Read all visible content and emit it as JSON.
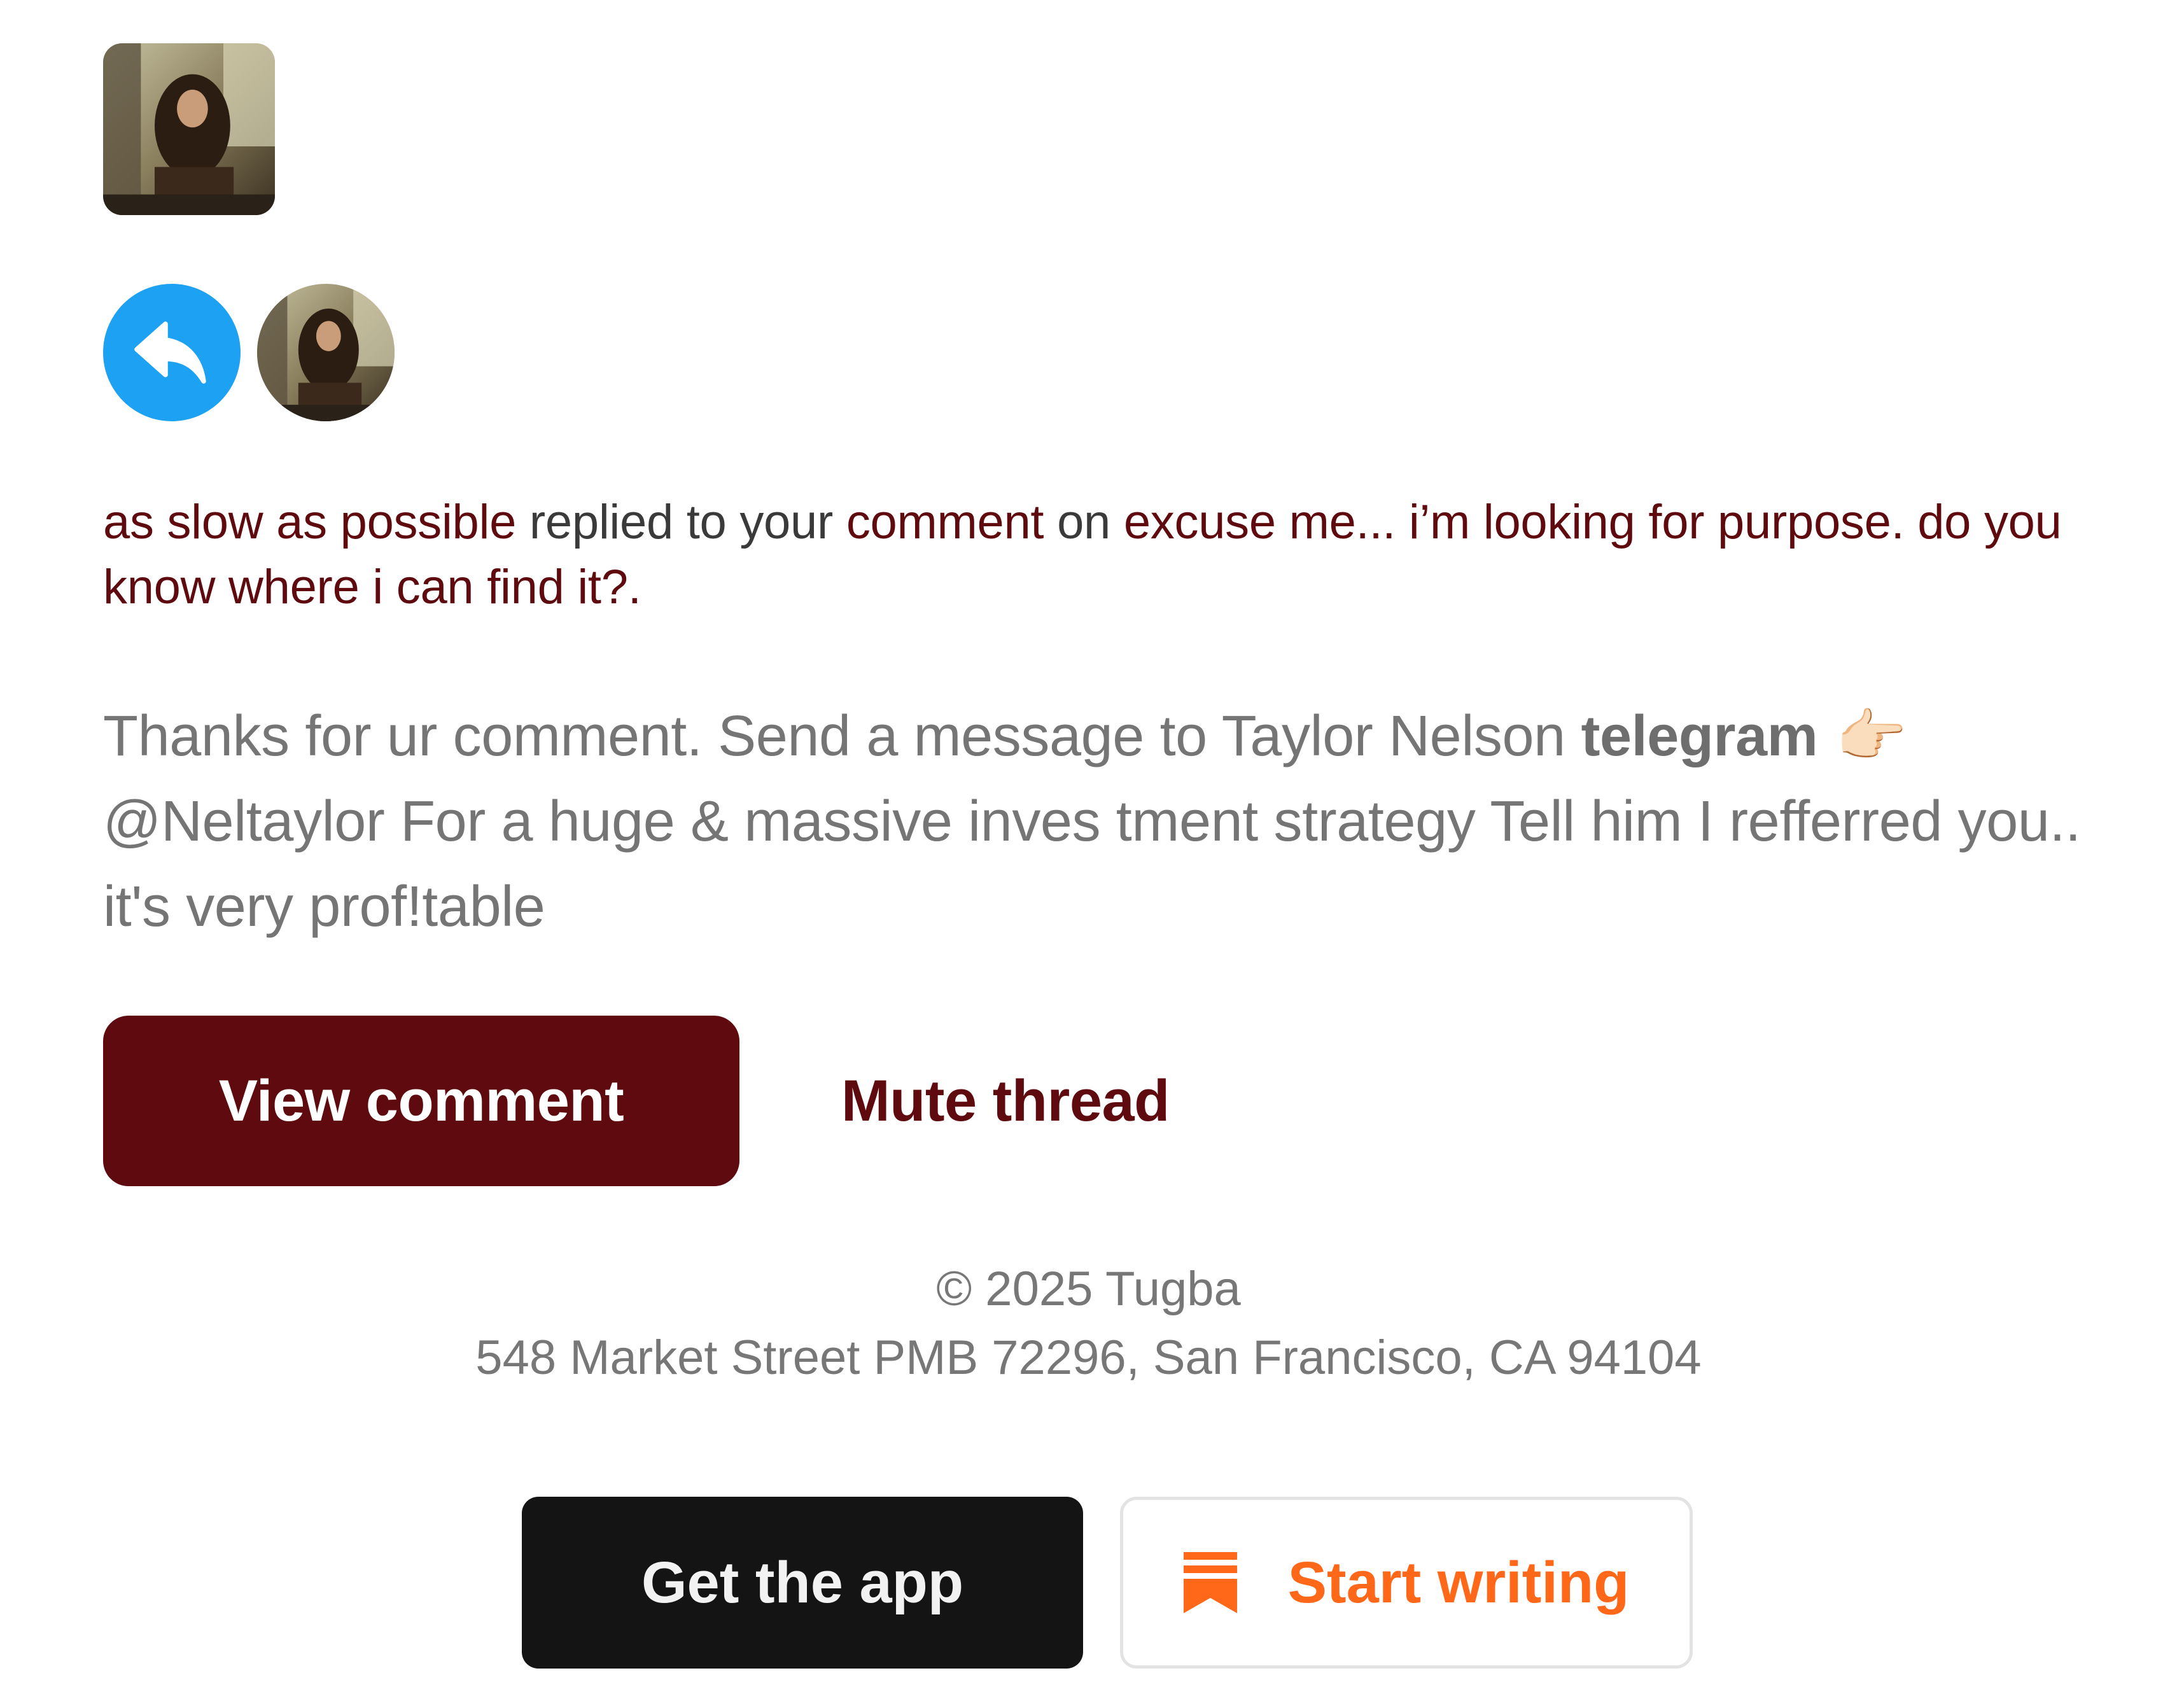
{
  "publication": {
    "avatar_alt": "publication avatar"
  },
  "reply": {
    "icon": "reply-arrow-icon",
    "icon_color": "#1da1f2"
  },
  "notification": {
    "actor": "as slow as possible",
    "text_replied": " replied to your ",
    "comment_link": "comment",
    "text_on": " on ",
    "post_title": "excuse me... i’m looking for purpose. do you know where i can find it?",
    "trailing": "."
  },
  "comment": {
    "part1": "Thanks for ur comment. Send a message to Taylor Nelson ",
    "bold": "telegram",
    "emoji": " 👉🏻",
    "part2": " @Neltaylor For a huge & massive inves tment strategy Tell him I refferred you.. it's very prof!table"
  },
  "actions": {
    "view_comment": "View comment",
    "mute_thread": "Mute thread"
  },
  "footer": {
    "copyright": "© 2025 Tugba",
    "address": "548 Market Street PMB 72296, San Francisco, CA 94104"
  },
  "app_buttons": {
    "get_app": "Get the app",
    "start_writing": "Start writing",
    "start_writing_icon": "substack-bookmark-icon"
  },
  "colors": {
    "brand": "#5e0a0f",
    "accent_orange": "#ff6719",
    "muted_text": "#757575"
  }
}
